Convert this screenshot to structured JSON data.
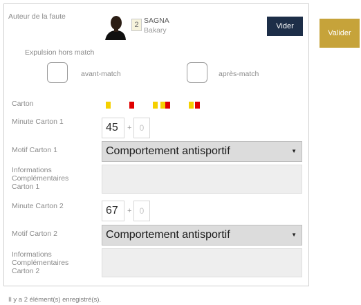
{
  "author": {
    "label": "Auteur de la faute",
    "number": "2",
    "last_name": "SAGNA",
    "first_name": "Bakary"
  },
  "buttons": {
    "vider": "Vider",
    "valider": "Valider"
  },
  "expulsion": {
    "label": "Expulsion hors match",
    "avant_label": "avant-match",
    "apres_label": "après-match"
  },
  "carton": {
    "label": "Carton",
    "options": [
      "yellow-card",
      "red-card",
      "two-yellow-card",
      "yellow-red-card"
    ]
  },
  "card1": {
    "minute_label": "Minute Carton 1",
    "minute": "45",
    "extra": "0",
    "plus": "+",
    "motif_label": "Motif Carton 1",
    "motif": "Comportement antisportif",
    "info_label": "Informations Complémentaires Carton 1"
  },
  "card2": {
    "minute_label": "Minute Carton 2",
    "minute": "67",
    "extra": "0",
    "plus": "+",
    "motif_label": "Motif Carton 2",
    "motif": "Comportement antisportif",
    "info_label": "Informations Complémentaires Carton 2"
  },
  "status": "Il y a 2 élément(s) enregistré(s).",
  "colors": {
    "vider_button": "#1d2e48",
    "valider_button": "#c6a33a",
    "yellow_card": "#f5d000",
    "red_card": "#e00000",
    "select_bg": "#dcdcdc"
  }
}
